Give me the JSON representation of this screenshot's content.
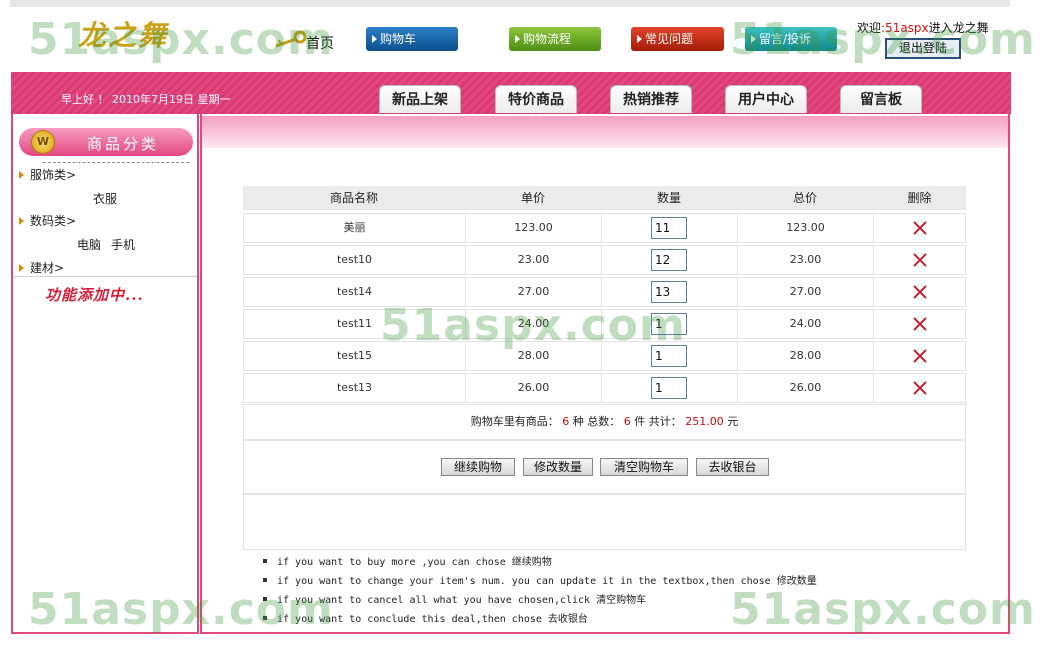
{
  "header": {
    "logo": "龙之舞",
    "home_label": "首页",
    "nav": {
      "cart": "购物车",
      "flow": "购物流程",
      "faq": "常见问题",
      "message": "留言/投诉"
    },
    "welcome_prefix": "欢迎",
    "welcome_user": ":51aspx",
    "welcome_suffix": "进入龙之舞",
    "logout_label": "退出登陆"
  },
  "band": {
    "greeting": "早上好 ！ 2010年7月19日 星期一",
    "tabs": [
      "新品上架",
      "特价商品",
      "热销推荐",
      "用户中心",
      "留言板"
    ]
  },
  "sidebar": {
    "title": "商品分类",
    "coin_label": "W",
    "categories": [
      {
        "label": "服饰类>",
        "subs": [
          "衣服"
        ]
      },
      {
        "label": "数码类>",
        "subs": [
          "电脑",
          "手机"
        ]
      },
      {
        "label": "建材>",
        "subs": []
      }
    ],
    "note": "功能添加中..."
  },
  "cart": {
    "headers": [
      "商品名称",
      "单价",
      "数量",
      "总价",
      "删除"
    ],
    "rows": [
      {
        "name": "美丽",
        "price": "123.00",
        "qty": "11",
        "total": "123.00"
      },
      {
        "name": "test10",
        "price": "23.00",
        "qty": "12",
        "total": "23.00"
      },
      {
        "name": "test14",
        "price": "27.00",
        "qty": "13",
        "total": "27.00"
      },
      {
        "name": "test11",
        "price": "24.00",
        "qty": "1",
        "total": "24.00"
      },
      {
        "name": "test15",
        "price": "28.00",
        "qty": "1",
        "total": "28.00"
      },
      {
        "name": "test13",
        "price": "26.00",
        "qty": "1",
        "total": "26.00"
      }
    ],
    "summary": {
      "prefix": "购物车里有商品：",
      "kinds": "6",
      "kinds_unit": "种 总数：",
      "count": "6",
      "count_unit": "件 共计：",
      "total": "251.00",
      "currency": "元"
    },
    "buttons": {
      "continue": "继续购物",
      "update": "修改数量",
      "clear": "清空购物车",
      "checkout": "去收银台"
    },
    "tips": [
      "if you want to buy more ,you can chose 继续购物",
      "if you want to change your item's num. you can update it in the textbox,then chose 修改数量",
      "if you want to cancel all what you have chosen,click 清空购物车",
      "if you want to conclude this deal,then chose 去收银台"
    ]
  },
  "watermark": "51aspx.com",
  "colors": {
    "brand_pink": "#e2487f",
    "price_red": "#c01010",
    "delete_red": "#c0283a"
  }
}
